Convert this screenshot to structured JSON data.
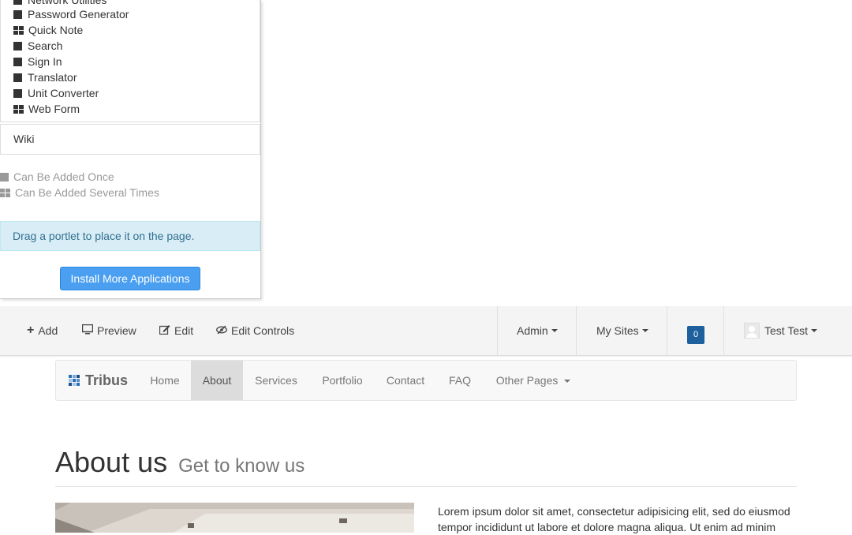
{
  "add_panel": {
    "applications": [
      {
        "label": "Network Utilities",
        "icon": "single-instance-icon"
      },
      {
        "label": "Password Generator",
        "icon": "single-instance-icon"
      },
      {
        "label": "Quick Note",
        "icon": "multi-instance-icon"
      },
      {
        "label": "Search",
        "icon": "single-instance-icon"
      },
      {
        "label": "Sign In",
        "icon": "single-instance-icon"
      },
      {
        "label": "Translator",
        "icon": "single-instance-icon"
      },
      {
        "label": "Unit Converter",
        "icon": "single-instance-icon"
      },
      {
        "label": "Web Form",
        "icon": "multi-instance-icon"
      }
    ],
    "category": "Wiki",
    "legend": {
      "once": "Can Be Added Once",
      "several": "Can Be Added Several Times"
    },
    "info": "Drag a portlet to place it on the page.",
    "install_button": "Install More Applications"
  },
  "control_bar": {
    "add": "Add",
    "preview": "Preview",
    "edit": "Edit",
    "edit_controls": "Edit Controls",
    "admin": "Admin",
    "my_sites": "My Sites",
    "notifications": "0",
    "user": "Test Test"
  },
  "site_nav": {
    "brand": "Tribus",
    "items": [
      "Home",
      "About",
      "Services",
      "Portfolio",
      "Contact",
      "FAQ",
      "Other Pages"
    ],
    "active": "About"
  },
  "content": {
    "title": "About us",
    "subtitle": "Get to know us",
    "paragraph_line1": "Lorem ipsum dolor sit amet, consectetur adipisicing elit, sed do eiusmod",
    "paragraph_line2": "tempor incididunt ut labore et dolore magna aliqua. Ut enim ad minim"
  },
  "colors": {
    "install_button": "#4a9ff0",
    "notification_badge": "#1e5f9e",
    "info_background": "#d9edf7",
    "nav_active": "#dcdcdc"
  }
}
